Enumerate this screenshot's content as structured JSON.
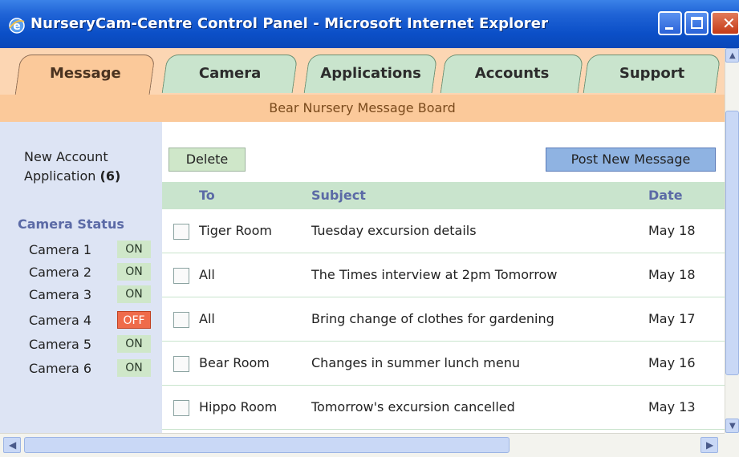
{
  "window": {
    "title": "NurseryCam-Centre Control Panel - Microsoft Internet Explorer",
    "icon": "ie-icon"
  },
  "tabs": [
    {
      "label": "Message",
      "active": true
    },
    {
      "label": "Camera",
      "active": false
    },
    {
      "label": "Applications",
      "active": false
    },
    {
      "label": "Accounts",
      "active": false
    },
    {
      "label": "Support",
      "active": false
    }
  ],
  "board_title": "Bear Nursery Message Board",
  "sidebar": {
    "new_account_line1": "New Account",
    "new_account_line2": "Application",
    "new_account_count": "(6)",
    "camera_status_title": "Camera Status",
    "cameras": [
      {
        "name": "Camera 1",
        "state": "ON"
      },
      {
        "name": "Camera 2",
        "state": "ON"
      },
      {
        "name": "Camera 3",
        "state": "ON"
      },
      {
        "name": "Camera 4",
        "state": "OFF"
      },
      {
        "name": "Camera 5",
        "state": "ON"
      },
      {
        "name": "Camera 6",
        "state": "ON"
      }
    ]
  },
  "toolbar": {
    "delete_label": "Delete",
    "post_label": "Post New Message"
  },
  "table": {
    "headers": {
      "to": "To",
      "subject": "Subject",
      "date": "Date"
    },
    "rows": [
      {
        "to": "Tiger Room",
        "subject": "Tuesday excursion details",
        "date": "May 18"
      },
      {
        "to": "All",
        "subject": "The Times interview at 2pm Tomorrow",
        "date": "May 18"
      },
      {
        "to": "All",
        "subject": "Bring change of clothes for gardening",
        "date": "May 17"
      },
      {
        "to": "Bear Room",
        "subject": "Changes in summer lunch menu",
        "date": "May 16"
      },
      {
        "to": "Hippo Room",
        "subject": "Tomorrow's excursion cancelled",
        "date": "May 13"
      }
    ]
  },
  "colors": {
    "tab_active": "#fbc99a",
    "tab_inactive": "#c9e4cd",
    "camera_off": "#ef6b4a",
    "camera_on": "#cfe7c9"
  }
}
